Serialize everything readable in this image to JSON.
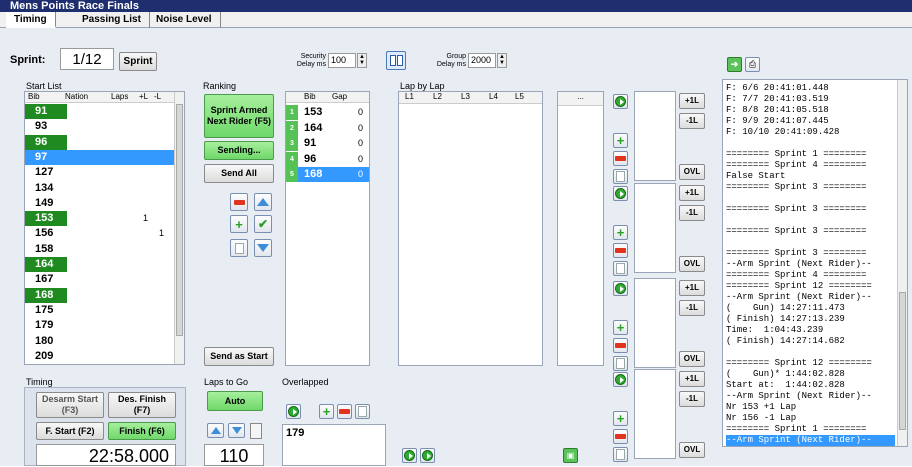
{
  "app": {
    "title": "Mens Points Race Finals"
  },
  "tabs": [
    {
      "label": "Timing"
    },
    {
      "label": "Passing List"
    },
    {
      "label": "Noise Level"
    }
  ],
  "sprint": {
    "label": "Sprint:",
    "value": "1/12",
    "button": "Sprint"
  },
  "security": {
    "label1": "Security",
    "label2": "Delay ms",
    "value": "100"
  },
  "group": {
    "label1": "Group",
    "label2": "Delay ms",
    "value": "2000"
  },
  "start_list": {
    "title": "Start List",
    "headers": [
      "Bib",
      "Nation",
      "Laps",
      "+L",
      "-L"
    ],
    "rows": [
      {
        "bib": "91",
        "laps": "",
        "pl": "",
        "ml": "",
        "hl": "green"
      },
      {
        "bib": "93",
        "laps": "",
        "pl": "",
        "ml": "",
        "hl": ""
      },
      {
        "bib": "96",
        "laps": "",
        "pl": "",
        "ml": "",
        "hl": "green"
      },
      {
        "bib": "97",
        "laps": "",
        "pl": "",
        "ml": "",
        "hl": "blue"
      },
      {
        "bib": "127",
        "laps": "",
        "pl": "",
        "ml": "",
        "hl": ""
      },
      {
        "bib": "134",
        "laps": "",
        "pl": "",
        "ml": "",
        "hl": ""
      },
      {
        "bib": "149",
        "laps": "",
        "pl": "",
        "ml": "",
        "hl": ""
      },
      {
        "bib": "153",
        "laps": "",
        "pl": "1",
        "ml": "",
        "hl": "green"
      },
      {
        "bib": "156",
        "laps": "",
        "pl": "",
        "ml": "1",
        "hl": ""
      },
      {
        "bib": "158",
        "laps": "",
        "pl": "",
        "ml": "",
        "hl": ""
      },
      {
        "bib": "164",
        "laps": "",
        "pl": "",
        "ml": "",
        "hl": "green"
      },
      {
        "bib": "167",
        "laps": "",
        "pl": "",
        "ml": "",
        "hl": ""
      },
      {
        "bib": "168",
        "laps": "",
        "pl": "",
        "ml": "",
        "hl": "green"
      },
      {
        "bib": "175",
        "laps": "",
        "pl": "",
        "ml": "",
        "hl": ""
      },
      {
        "bib": "179",
        "laps": "",
        "pl": "",
        "ml": "",
        "hl": ""
      },
      {
        "bib": "180",
        "laps": "",
        "pl": "",
        "ml": "",
        "hl": ""
      },
      {
        "bib": "209",
        "laps": "",
        "pl": "",
        "ml": "",
        "hl": ""
      }
    ]
  },
  "ranking": {
    "title": "Ranking",
    "armed": "Sprint Armed Next Rider (F5)",
    "sending": "Sending...",
    "send_all": "Send All",
    "send_as_start": "Send as Start",
    "headers": [
      "Bib",
      "Gap"
    ],
    "rows": [
      {
        "pos": "1",
        "bib": "153",
        "gap": "0"
      },
      {
        "pos": "2",
        "bib": "164",
        "gap": "0"
      },
      {
        "pos": "3",
        "bib": "91",
        "gap": "0"
      },
      {
        "pos": "4",
        "bib": "96",
        "gap": "0"
      },
      {
        "pos": "5",
        "bib": "168",
        "gap": "0"
      }
    ]
  },
  "lap_by_lap": {
    "title": "Lap by Lap",
    "headers": [
      "L1",
      "L2",
      "L3",
      "L4",
      "L5"
    ],
    "more": "..."
  },
  "lap_groups": [
    {
      "p1": "+1L",
      "m1": "-1L",
      "ovl": "OVL"
    },
    {
      "p1": "+1L",
      "m1": "-1L",
      "ovl": "OVL"
    },
    {
      "p1": "+1L",
      "m1": "-1L",
      "ovl": "OVL"
    },
    {
      "p1": "+1L",
      "m1": "-1L",
      "ovl": "OVL"
    }
  ],
  "timing": {
    "title": "Timing",
    "desarm": "Desarm Start (F3)",
    "des_finish": "Des. Finish (F7)",
    "f_start": "F. Start (F2)",
    "finish": "Finish (F6)",
    "clock": "22:58.000"
  },
  "laps_to_go": {
    "title": "Laps to Go",
    "auto": "Auto",
    "value": "110"
  },
  "overlapped": {
    "title": "Overlapped",
    "value": "179"
  },
  "log": {
    "lines": [
      "F: 6/6 20:41:01.448",
      "F: 7/7 20:41:03.519",
      "F: 8/8 20:41:05.518",
      "F: 9/9 20:41:07.445",
      "F: 10/10 20:41:09.428",
      "",
      "======== Sprint 1 ========",
      "======== Sprint 4 ========",
      "False Start",
      "======== Sprint 3 ========",
      "",
      "======== Sprint 3 ========",
      "",
      "======== Sprint 3 ========",
      "",
      "======== Sprint 3 ========",
      "--Arm Sprint (Next Rider)--",
      "======== Sprint 4 ========",
      "======== Sprint 12 ========",
      "--Arm Sprint (Next Rider)--",
      "(    Gun) 14:27:11.473",
      "( Finish) 14:27:13.239",
      "Time:  1:04:43.239",
      "( Finish) 14:27:14.682",
      "",
      "======== Sprint 12 ========",
      "(    Gun)* 1:44:02.828",
      "Start at:  1:44:02.828",
      "--Arm Sprint (Next Rider)--",
      "Nr 153 +1 Lap",
      "Nr 156 -1 Lap",
      "======== Sprint 1 ========",
      "--Arm Sprint (Next Rider)--"
    ],
    "selected": 32
  },
  "colors": {
    "green": "#1f8a1f",
    "blue": "#3399ff",
    "title": "#1f2e6e"
  }
}
